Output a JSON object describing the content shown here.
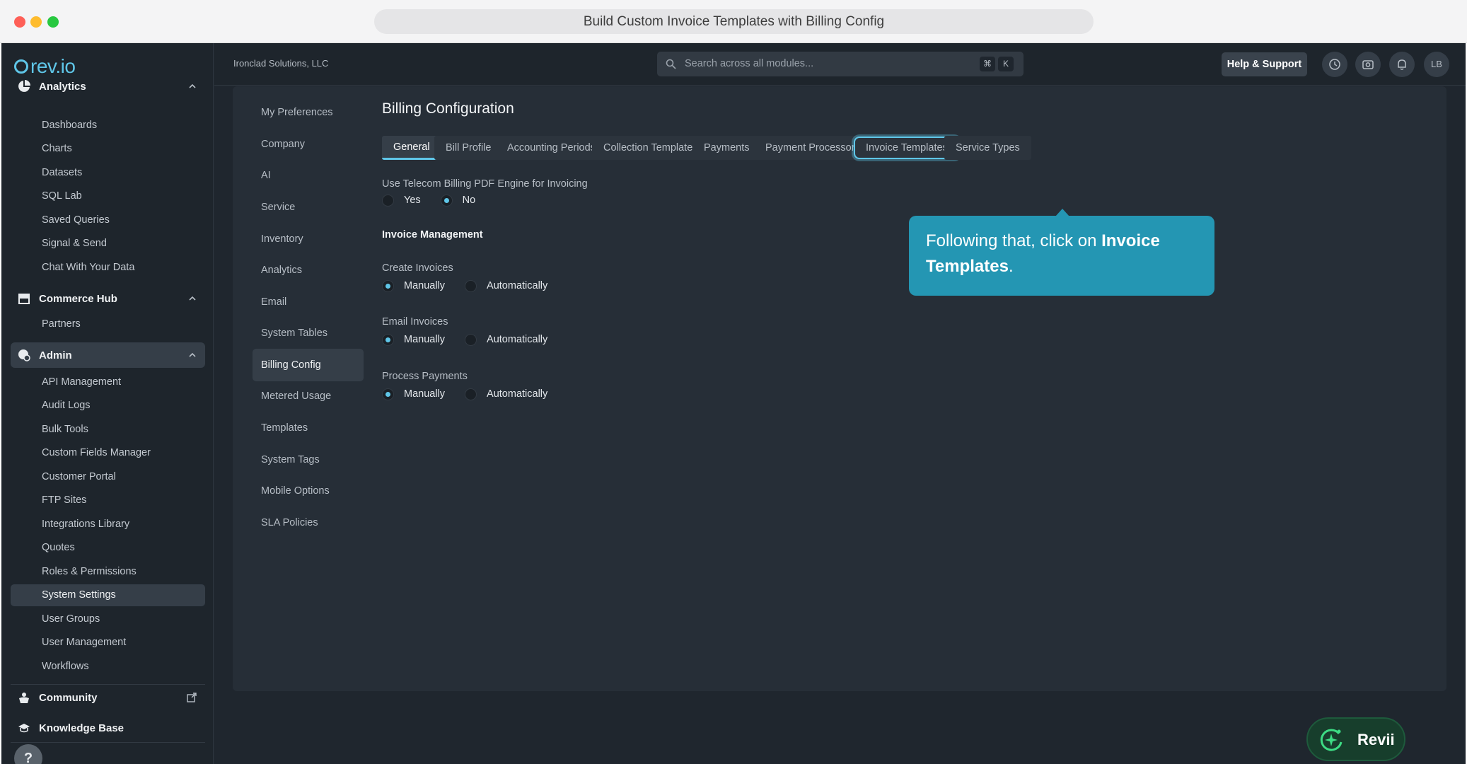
{
  "browser": {
    "title": "Build Custom Invoice Templates with Billing Config"
  },
  "logo": {
    "text": "rev.io"
  },
  "leftnav": {
    "sections": [
      {
        "label": "Analytics",
        "items": [
          "Dashboards",
          "Charts",
          "Datasets",
          "SQL Lab",
          "Saved Queries",
          "Signal & Send",
          "Chat With Your Data"
        ]
      },
      {
        "label": "Commerce Hub",
        "items": [
          "Partners"
        ]
      },
      {
        "label": "Admin",
        "items": [
          "API Management",
          "Audit Logs",
          "Bulk Tools",
          "Custom Fields Manager",
          "Customer Portal",
          "FTP Sites",
          "Integrations Library",
          "Quotes",
          "Roles & Permissions",
          "System Settings",
          "User Groups",
          "User Management",
          "Workflows"
        ]
      }
    ],
    "community": "Community",
    "knowledge_base": "Knowledge Base",
    "help": "?"
  },
  "topbar": {
    "org": "Ironclad Solutions, LLC",
    "search_placeholder": "Search across all modules...",
    "kbd_cmd": "⌘",
    "kbd_k": "K",
    "help_label": "Help & Support",
    "avatar": "LB"
  },
  "subnav": [
    "My Preferences",
    "Company",
    "AI",
    "Service",
    "Inventory",
    "Analytics",
    "Email",
    "System Tables",
    "Billing Config",
    "Metered Usage",
    "Templates",
    "System Tags",
    "Mobile Options",
    "SLA Policies"
  ],
  "main": {
    "title": "Billing Configuration",
    "tabs": [
      "General",
      "Bill Profile",
      "Accounting Periods",
      "Collection Templates",
      "Payments",
      "Payment Processors",
      "Invoice Templates",
      "Service Types"
    ],
    "pdf_engine": {
      "label": "Use Telecom Billing PDF Engine for Invoicing",
      "yes": "Yes",
      "no": "No"
    },
    "invoice_mgmt": "Invoice Management",
    "create_invoices": {
      "label": "Create Invoices",
      "opt1": "Manually",
      "opt2": "Automatically"
    },
    "email_invoices": {
      "label": "Email Invoices",
      "opt1": "Manually",
      "opt2": "Automatically"
    },
    "process_payments": {
      "label": "Process Payments",
      "opt1": "Manually",
      "opt2": "Automatically"
    }
  },
  "tooltip": {
    "prefix": "Following that, click on ",
    "bold": "Invoice Templates",
    "suffix": "."
  },
  "revii": {
    "label": "Revii"
  },
  "colors": {
    "accent": "#5fc6e8",
    "tooltip_bg": "#2496b3",
    "app_bg": "#1f262e",
    "panel_bg": "#262e37"
  }
}
